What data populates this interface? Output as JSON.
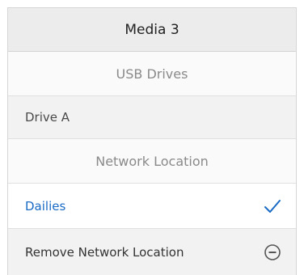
{
  "menu": {
    "title": "Media 3",
    "usb_section_label": "USB Drives",
    "usb_items": [
      {
        "label": "Drive A"
      }
    ],
    "network_section_label": "Network Location",
    "network_items": [
      {
        "label": "Dailies",
        "selected": true,
        "icon": "checkmark-icon"
      }
    ],
    "remove_label": "Remove Network Location",
    "remove_icon": "minus-circle-icon"
  },
  "colors": {
    "accent": "#1a6bc5",
    "header_bg": "#ececec",
    "item_bg": "#f2f2f2",
    "section_text": "#8a8a8a"
  }
}
